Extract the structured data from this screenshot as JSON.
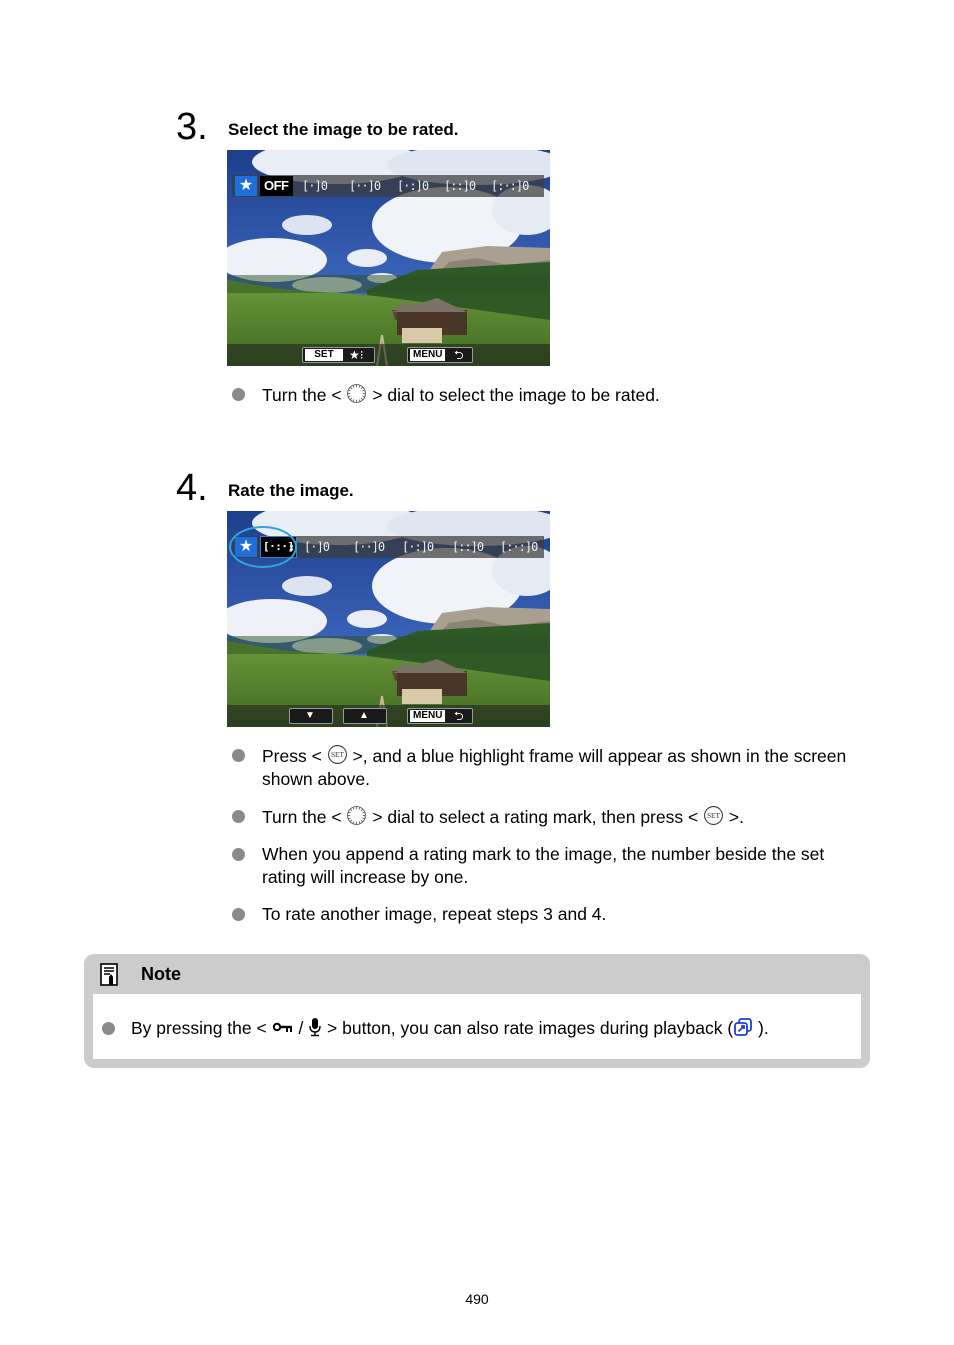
{
  "steps": [
    {
      "number": "3.",
      "title": "Select the image to be rated.",
      "screen": {
        "rating_selector": {
          "star_icon": "★",
          "current_value": "OFF",
          "ratings": [
            {
              "mark": "[·]",
              "count": "0"
            },
            {
              "mark": "[··]",
              "count": "0"
            },
            {
              "mark": "[·:]",
              "count": "0"
            },
            {
              "mark": "[::]",
              "count": "0"
            },
            {
              "mark": "[:·:]",
              "count": "0"
            }
          ]
        },
        "bottom_bar": {
          "set_label": "SET",
          "set_glyph": "★⁝",
          "menu_label": "MENU",
          "back_glyph": "⮌"
        }
      },
      "bullets": [
        {
          "before": "Turn the < ",
          "icon": "main-dial-icon",
          "after": " > dial to select the image to be rated."
        }
      ]
    },
    {
      "number": "4.",
      "title": "Rate the image.",
      "screen": {
        "rating_selector": {
          "star_icon": "★",
          "current_value": "[·:·]",
          "updown_glyph": "⇕",
          "ratings": [
            {
              "mark": "[·]",
              "count": "0"
            },
            {
              "mark": "[··]",
              "count": "0"
            },
            {
              "mark": "[·:]",
              "count": "0"
            },
            {
              "mark": "[::]",
              "count": "0"
            },
            {
              "mark": "[:·:]",
              "count": "0"
            }
          ]
        },
        "bottom_bar": {
          "down_glyph": "▼",
          "up_glyph": "▲",
          "menu_label": "MENU",
          "back_glyph": "⮌"
        }
      },
      "bullets": [
        {
          "before": "Press < ",
          "icon": "set-button-icon",
          "after": " >, and a blue highlight frame will appear as shown in the screen shown above."
        },
        {
          "before": "Turn the < ",
          "icon": "main-dial-icon",
          "after": " > dial to select a rating mark, then press < ",
          "icon2": "set-button-icon",
          "after2": " >."
        },
        {
          "text": "When you append a rating mark to the image, the number beside the set rating will increase by one."
        },
        {
          "text": "To rate another image, repeat steps 3 and 4."
        }
      ]
    }
  ],
  "note": {
    "title": "Note",
    "bullet": {
      "before": "By pressing the < ",
      "separator": " / ",
      "middle": " > button, you can also rate images during playback (",
      "after": " )."
    }
  },
  "page_number": "490",
  "colors": {
    "accent_blue": "#1e6fd9",
    "highlight_ring": "#2fa6d8",
    "note_background": "#cccccc",
    "bullet_dot": "#8a8a8a"
  }
}
